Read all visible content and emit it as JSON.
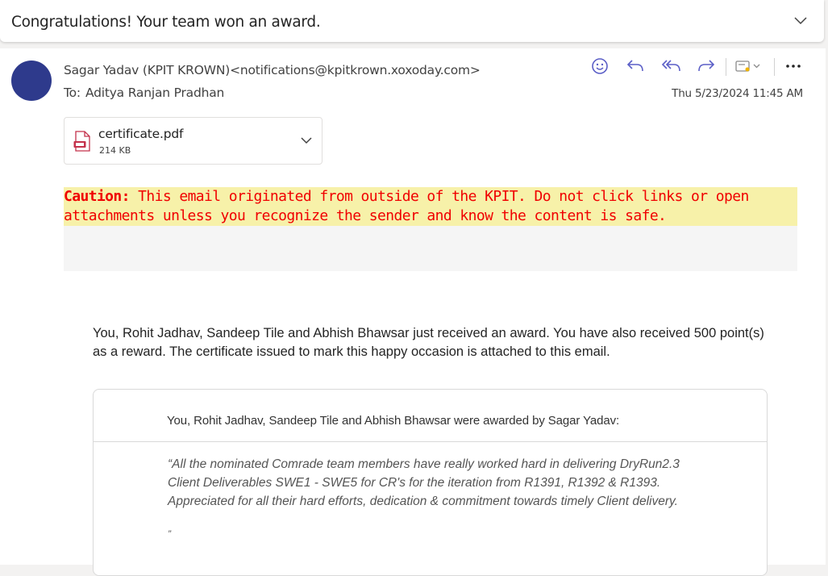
{
  "subject": {
    "title": "Congratulations! Your team won an award.",
    "expand_icon": "chevron-down-icon"
  },
  "message": {
    "sender_name": "Sagar Yadav (KPIT KROWN)",
    "sender_email": "<notifications@kpitkrown.xoxoday.com>",
    "to_label": "To:",
    "to_name": "Aditya Ranjan Pradhan",
    "date": "Thu 5/23/2024 11:45 AM",
    "avatar_color": "#2e3a8c",
    "actions": {
      "emoji_icon": "emoji-icon",
      "reply_icon": "reply-icon",
      "reply_all_icon": "reply-all-icon",
      "forward_icon": "forward-icon",
      "apps_icon": "apps-icon",
      "more_icon": "more-icon",
      "accent_color": "#5b5fc7"
    }
  },
  "attachment": {
    "name": "certificate.pdf",
    "size": "214 KB",
    "icon": "pdf-file-icon"
  },
  "caution": {
    "label": "Caution:",
    "text": " This email originated from outside of the KPIT. Do not click links or open attachments unless you recognize the sender and know the content is safe.",
    "text_color": "#f00000",
    "background": "#f7f1a9"
  },
  "body": {
    "intro": "You, Rohit Jadhav, Sandeep Tile and Abhish Bhawsar just received an award. You have also received 500 point(s) as a reward. The certificate issued to mark this happy occasion is attached to this email.",
    "award_header": "You, Rohit Jadhav, Sandeep Tile and Abhish Bhawsar were awarded by Sagar Yadav:",
    "quote": "“All the nominated Comrade team members have really worked hard in delivering DryRun2.3 Client Deliverables SWE1 - SWE5 for CR's for the iteration from R1391, R1392 & R1393. Appreciated for all their hard efforts, dedication & commitment towards timely Client delivery.",
    "quote_close": "”"
  }
}
